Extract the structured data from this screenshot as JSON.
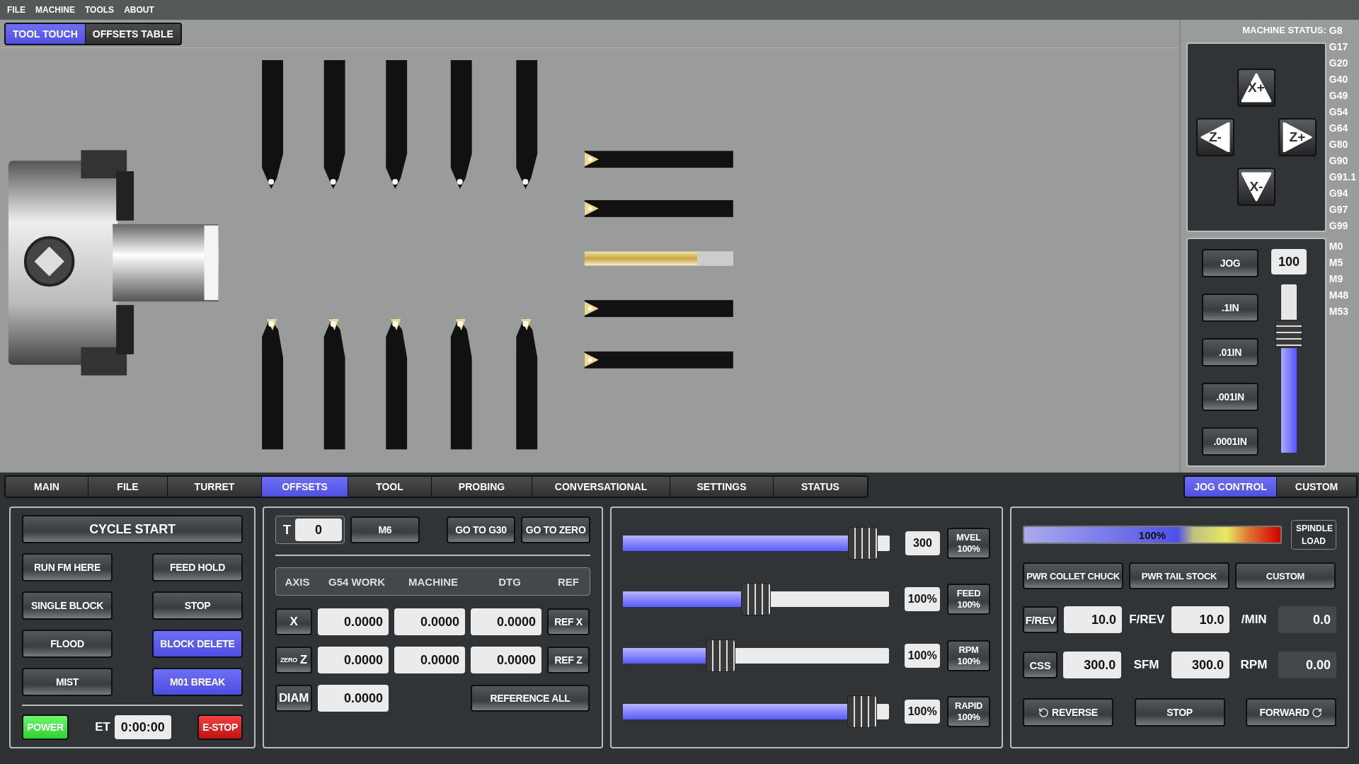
{
  "menu": [
    "FILE",
    "MACHINE",
    "TOOLS",
    "ABOUT"
  ],
  "view_tabs": [
    {
      "label": "TOOL TOUCH",
      "selected": true
    },
    {
      "label": "OFFSETS TABLE",
      "selected": false
    }
  ],
  "machine_status": {
    "label": "MACHINE STATUS:",
    "g_codes": [
      "G8",
      "G17",
      "G20",
      "G40",
      "G49",
      "G54",
      "G64",
      "G80",
      "G90",
      "G91.1",
      "G94",
      "G97",
      "G99"
    ],
    "m_codes": [
      "M0",
      "M5",
      "M9",
      "M48",
      "M53"
    ]
  },
  "jog_pad": [
    {
      "kind": "x_plus",
      "label": "X+"
    },
    {
      "kind": "z_minus",
      "label": "Z-"
    },
    {
      "kind": "z_plus",
      "label": "Z+"
    },
    {
      "kind": "x_minus",
      "label": "X-"
    }
  ],
  "jog": {
    "mode": "JOG",
    "increments": [
      ".1IN",
      ".01IN",
      ".001IN",
      ".0001IN"
    ],
    "rate": "100",
    "level": 0.75
  },
  "main_tabs": [
    {
      "label": "MAIN",
      "selected": false
    },
    {
      "label": "FILE",
      "selected": false
    },
    {
      "label": "TURRET",
      "selected": false
    },
    {
      "label": "OFFSETS",
      "selected": true
    },
    {
      "label": "TOOL",
      "selected": false
    },
    {
      "label": "PROBING",
      "selected": false
    },
    {
      "label": "CONVERSATIONAL",
      "selected": false
    },
    {
      "label": "SETTINGS",
      "selected": false
    },
    {
      "label": "STATUS",
      "selected": false
    }
  ],
  "side_tabs": [
    {
      "label": "JOG CONTROL",
      "selected": true
    },
    {
      "label": "CUSTOM",
      "selected": false
    }
  ],
  "program": {
    "cycle_start": "CYCLE START",
    "buttons": [
      {
        "label": "RUN FM HERE",
        "on": false
      },
      {
        "label": "FEED HOLD",
        "on": false
      },
      {
        "label": "SINGLE BLOCK",
        "on": false
      },
      {
        "label": "STOP",
        "on": false
      },
      {
        "label": "FLOOD",
        "on": false
      },
      {
        "label": "BLOCK DELETE",
        "on": true
      },
      {
        "label": "MIST",
        "on": false
      },
      {
        "label": "M01 BREAK",
        "on": true
      }
    ],
    "power": "POWER",
    "et_label": "ET",
    "et_value": "0:00:00",
    "estop": "E-STOP"
  },
  "offsets": {
    "tool_label": "T",
    "tool_value": "0",
    "actions": [
      "M6",
      "GO TO G30",
      "GO TO ZERO"
    ],
    "columns": [
      "AXIS",
      "G54 WORK",
      "MACHINE",
      "DTG",
      "REF"
    ],
    "rows": [
      {
        "axis": "X",
        "values": [
          "0.0000",
          "0.0000",
          "0.0000"
        ],
        "ref": "REF X"
      },
      {
        "axis": "Z",
        "zero_label": "ZERO",
        "values": [
          "0.0000",
          "0.0000",
          "0.0000"
        ],
        "ref": "REF Z"
      },
      {
        "axis": "DIAM",
        "values": [
          "0.0000"
        ]
      }
    ],
    "reference_all": "REFERENCE ALL"
  },
  "overrides": [
    {
      "value": "300",
      "label": "MVEL",
      "reading": "100%",
      "level": 0.95
    },
    {
      "value": "100%",
      "label": "FEED",
      "reading": "100%",
      "level": 0.5
    },
    {
      "value": "100%",
      "label": "RPM",
      "reading": "100%",
      "level": 0.35
    },
    {
      "value": "100%",
      "label": "RAPID",
      "reading": "100%",
      "level": 0.95
    }
  ],
  "spindle": {
    "load": {
      "reading": "100%",
      "level": 1,
      "label": "SPINDLE LOAD"
    },
    "buttons": [
      "PWR COLLET CHUCK",
      "PWR TAIL STOCK",
      "CUSTOM"
    ],
    "rows": [
      {
        "mode": "F/REV",
        "value": "10.0",
        "unit": "F/REV",
        "value2": "10.0",
        "unit2": "/MIN",
        "readout": "0.0"
      },
      {
        "mode": "CSS",
        "value": "300.0",
        "unit": "SFM",
        "value2": "300.0",
        "unit2": "RPM",
        "readout": "0.00"
      }
    ],
    "reverse": "REVERSE",
    "stop": "STOP",
    "forward": "FORWARD"
  }
}
